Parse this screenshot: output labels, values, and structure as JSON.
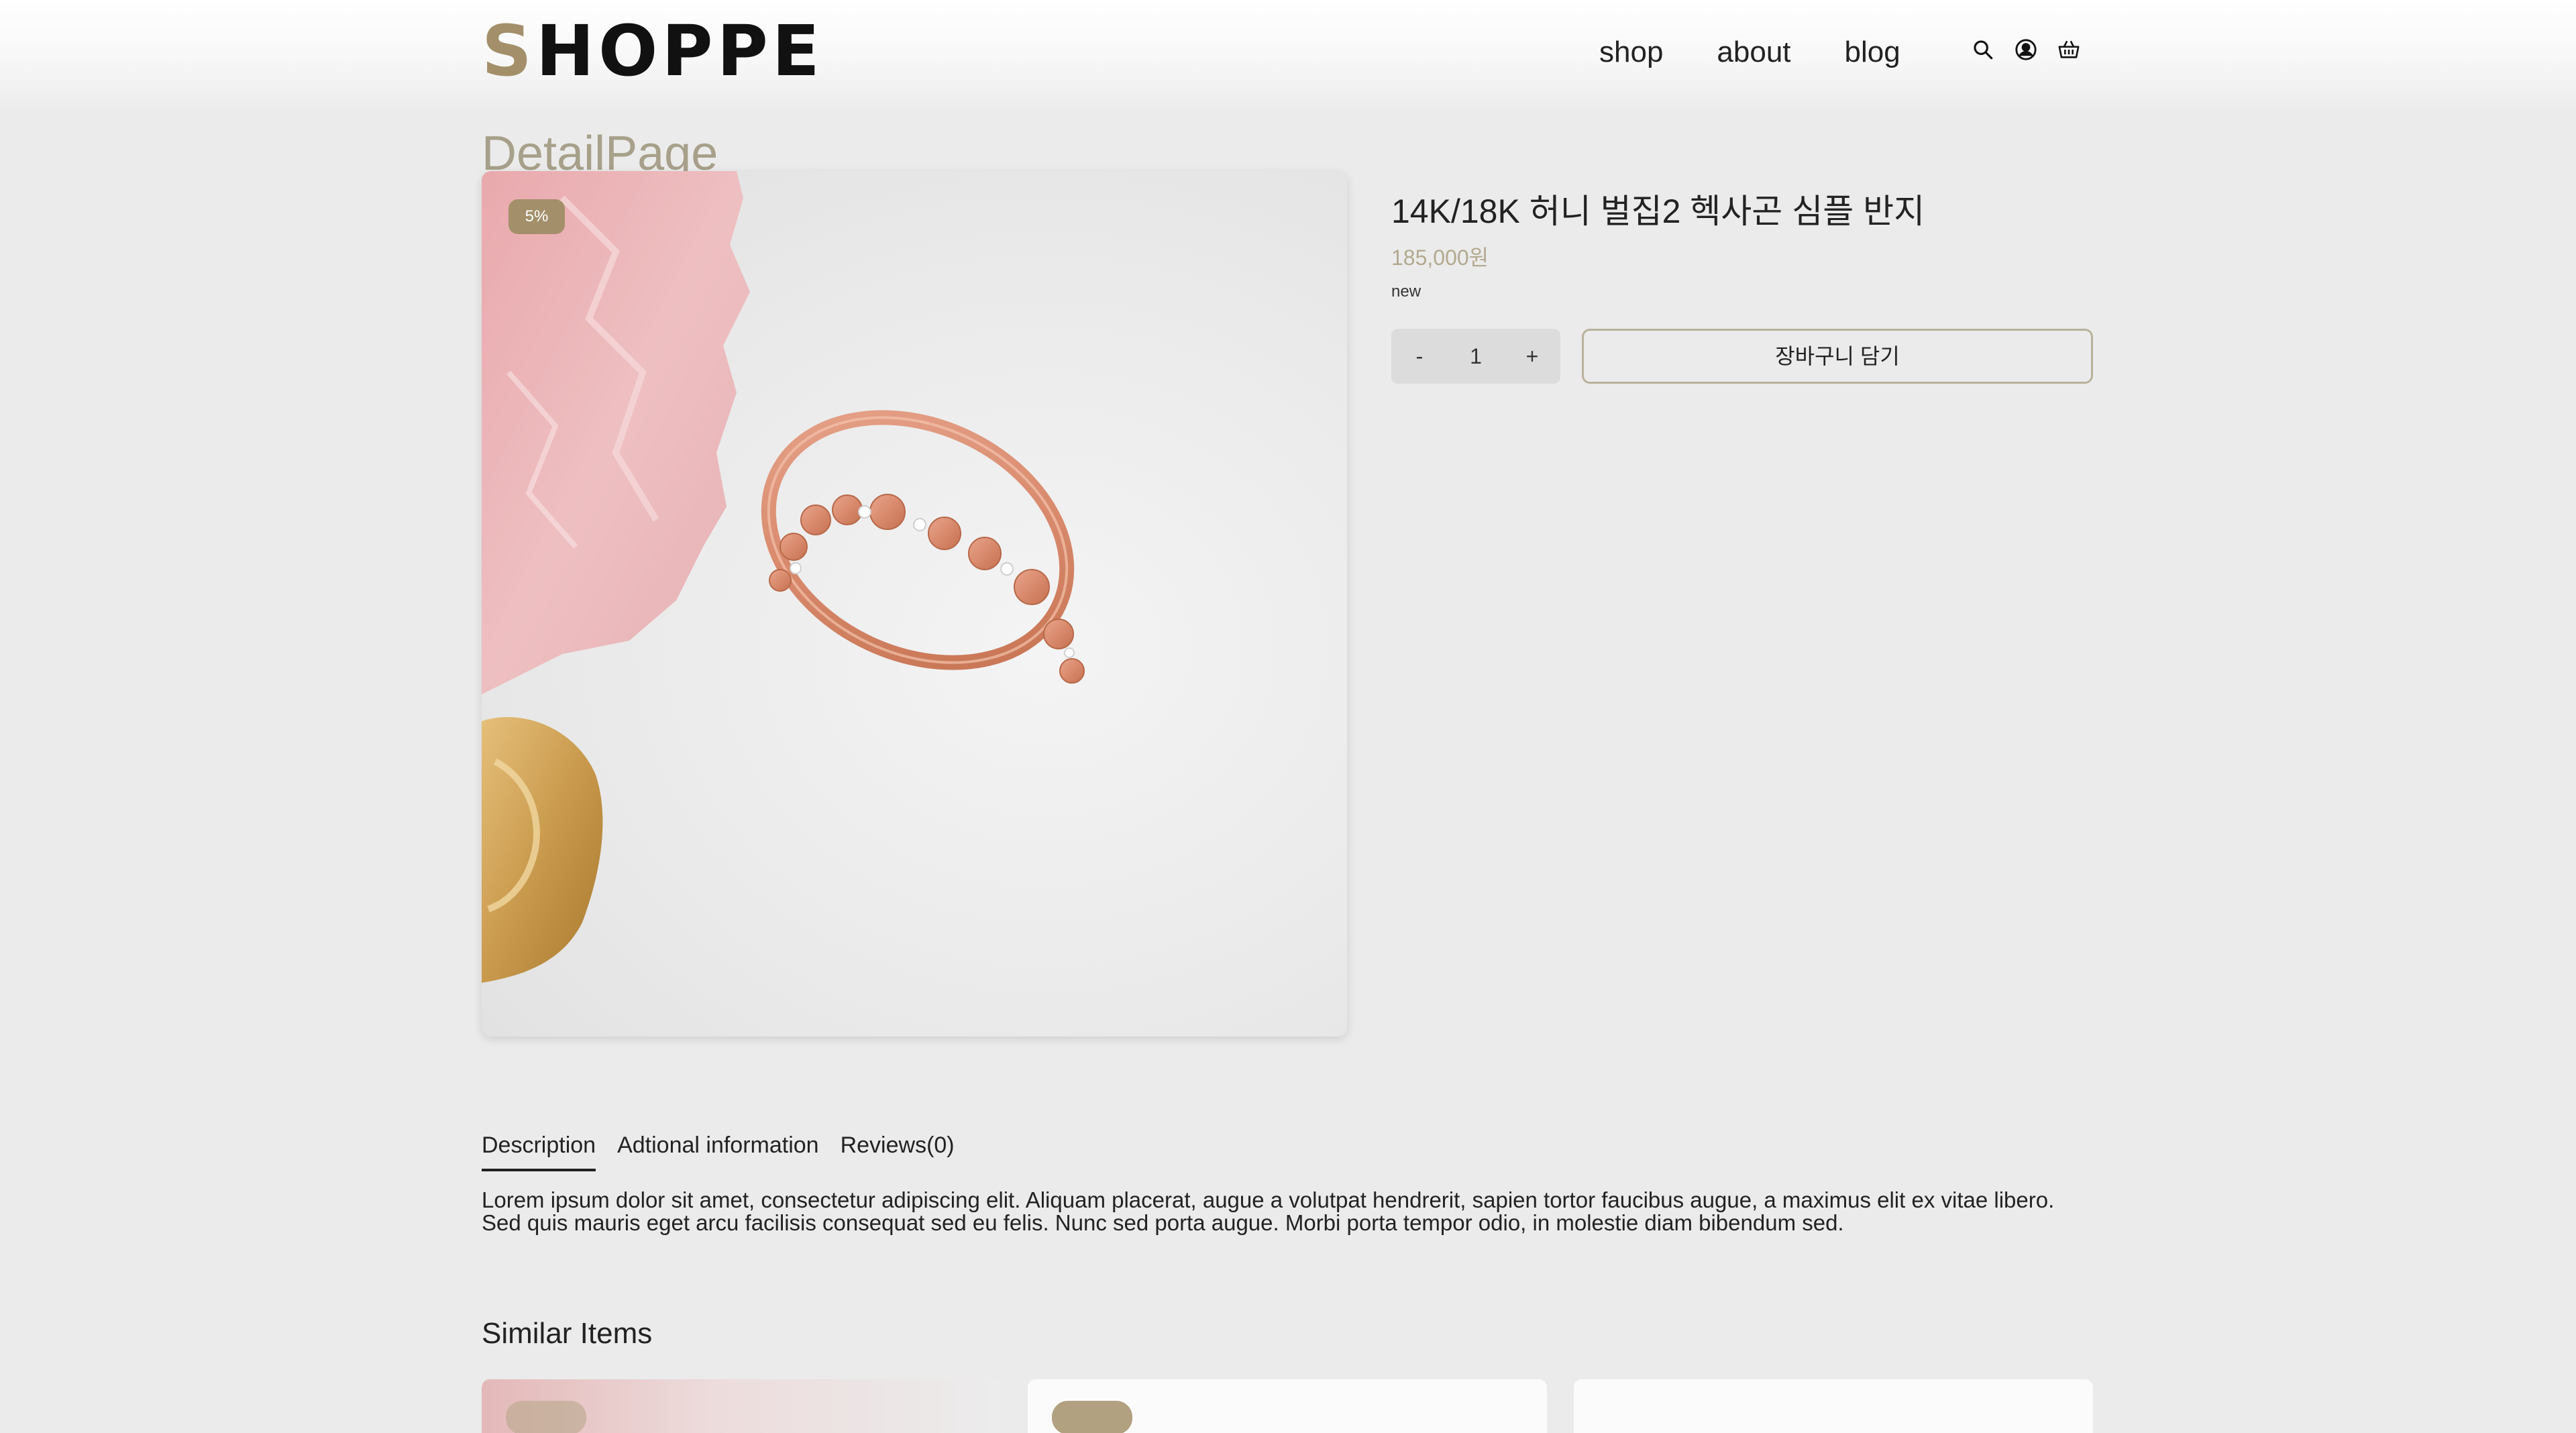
{
  "header": {
    "logo_first": "S",
    "logo_rest": "HOPPE",
    "nav": [
      {
        "label": "shop"
      },
      {
        "label": "about"
      },
      {
        "label": "blog"
      }
    ],
    "icons": [
      "search-icon",
      "user-icon",
      "cart-icon"
    ]
  },
  "page": {
    "title": "DetailPage"
  },
  "product": {
    "name": "14K/18K 허니 벌집2 헥사곤 심플 반지",
    "price": "185,000원",
    "tag": "new",
    "discount_badge": "5%",
    "quantity": {
      "minus": "-",
      "value": "1",
      "plus": "+"
    },
    "cart_button": "장바구니 담기"
  },
  "tabs": [
    {
      "label": "Description",
      "active": true
    },
    {
      "label": "Adtional information",
      "active": false
    },
    {
      "label": "Reviews(0)",
      "active": false
    }
  ],
  "description": "Lorem ipsum dolor sit amet, consectetur adipiscing elit. Aliquam placerat, augue a volutpat hendrerit, sapien tortor faucibus augue, a maximus elit ex vitae libero. Sed quis mauris eget arcu facilisis consequat sed eu felis. Nunc sed porta augue. Morbi porta tempor odio, in molestie diam bibendum sed.",
  "similar": {
    "heading": "Similar Items"
  },
  "colors": {
    "accent": "#a3906a",
    "price": "#b3a98f",
    "background": "#ebebeb"
  }
}
